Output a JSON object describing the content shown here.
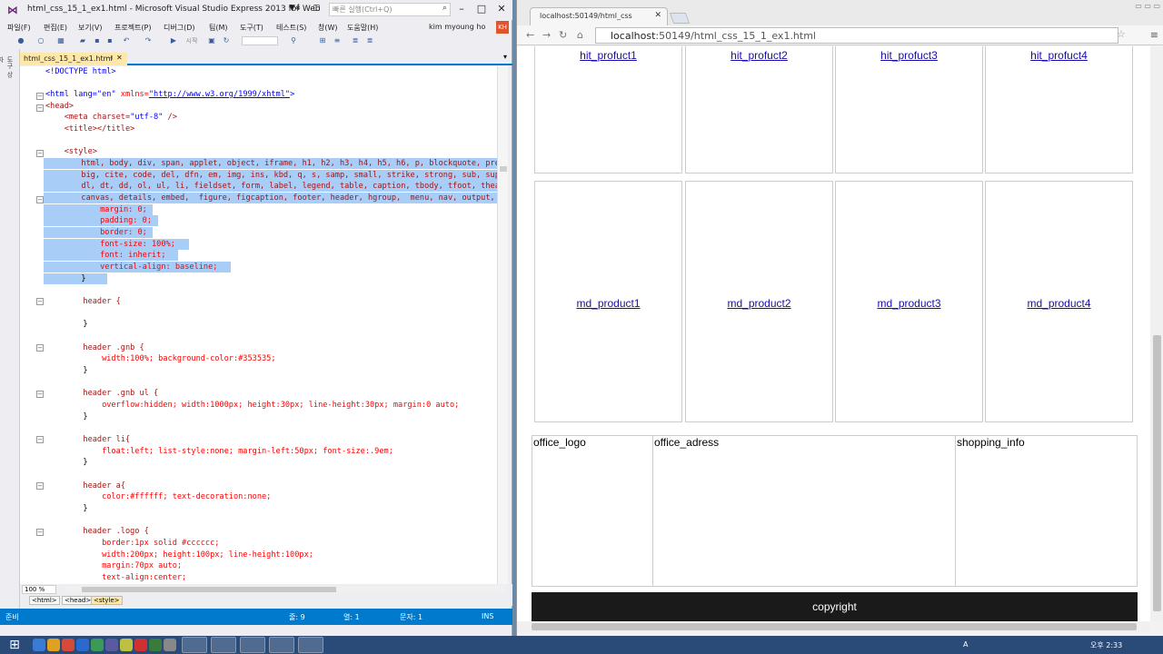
{
  "vs": {
    "title": "html_css_15_1_ex1.html - Microsoft Visual Studio Express 2013 for Web",
    "flag_count": "4",
    "quick_launch": "빠른 실행(Ctrl+Q)",
    "menu": [
      "파일(F)",
      "편집(E)",
      "보기(V)",
      "프로젝트(P)",
      "디버그(D)",
      "팀(M)",
      "도구(T)",
      "테스트(S)",
      "창(W)",
      "도움말(H)"
    ],
    "user": "kim myoung ho",
    "user_initials": "KH",
    "run_label": "시작",
    "side_tab": "도구 상자",
    "tab_name": "html_css_15_1_ex1.html",
    "zoom": "100 %",
    "crumbs": [
      "<html>",
      "<head>",
      "<style>"
    ],
    "status": {
      "ready": "준비",
      "line": "줄: 9",
      "col": "열: 1",
      "char": "문자: 1",
      "ins": "INS"
    },
    "code": {
      "l1": "<!DOCTYPE html>",
      "l3a": "<html lang=",
      "l3b": "\"en\"",
      "l3c": " xmlns=",
      "l3d": "\"http://www.w3.org/1999/xhtml\"",
      "l3e": ">",
      "l4": "<head>",
      "l5a": "    <meta charset=",
      "l5b": "\"utf-8\"",
      "l5c": " />",
      "l6": "    <title></title>",
      "l8": "    <style>",
      "l9": "        html, body, div, span, applet, object, iframe, h1, h2, h3, h4, h5, h6, p, blockquote, pre,",
      "l10": "        big, cite, code, del, dfn, em, img, ins, kbd, q, s, samp, small, strike, strong, sub, sup,",
      "l11": "        dl, dt, dd, ol, ul, li, fieldset, form, label, legend, table, caption, tbody, tfoot, thead,",
      "l12": "        canvas, details, embed,  figure, figcaption, footer, header, hgroup,  menu, nav, output, ruby,",
      "l13": "            margin: 0;",
      "l14": "            padding: 0;",
      "l15": "            border: 0;",
      "l16": "            font-size: 100%;",
      "l17": "            font: inherit;",
      "l18": "            vertical-align: baseline;",
      "l19": "        }",
      "l21": "        header {",
      "l23": "        }",
      "l25": "        header .gnb {",
      "l26": "            width:100%; background-color:#353535;",
      "l27": "        }",
      "l29": "        header .gnb ul {",
      "l30": "            overflow:hidden; width:1000px; height:30px; line-height:30px; margin:0 auto;",
      "l31": "        }",
      "l33": "        header li{",
      "l34": "            float:left; list-style:none; margin-left:50px; font-size:.9em;",
      "l35": "        }",
      "l37": "        header a{",
      "l38": "            color:#ffffff; text-decoration:none;",
      "l39": "        }",
      "l41": "        header .logo {",
      "l42": "            border:1px solid #cccccc;",
      "l43": "            width:200px; height:100px; line-height:100px;",
      "l44": "            margin:70px auto;",
      "l45": "            text-align:center;"
    }
  },
  "browser": {
    "tab_title": "localhost:50149/html_css",
    "url_host": "localhost",
    "url_rest": ":50149/html_css_15_1_ex1.html",
    "hit_products": [
      "hit_profuct1",
      "hit_profuct2",
      "hit_profuct3",
      "hit_profuct4"
    ],
    "md_products": [
      "md_product1",
      "md_product2",
      "md_product3",
      "md_product4"
    ],
    "footer": {
      "logo": "office_logo",
      "address": "office_adress",
      "shopping": "shopping_info"
    },
    "copyright": "copyright"
  },
  "taskbar": {
    "lang": "A",
    "time": "오후 2:33"
  }
}
